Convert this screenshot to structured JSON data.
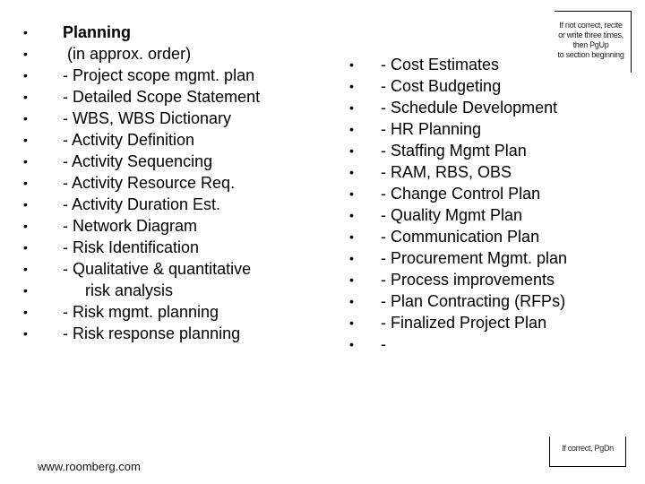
{
  "left_list": [
    {
      "text": "Planning",
      "style": "title"
    },
    {
      "text": " (in approx. order)",
      "style": "normal"
    },
    {
      "text": "- Project scope mgmt. plan",
      "style": "normal"
    },
    {
      "text": "- Detailed Scope Statement",
      "style": "normal"
    },
    {
      "text": "- WBS, WBS Dictionary",
      "style": "normal"
    },
    {
      "text": "- Activity Definition",
      "style": "normal"
    },
    {
      "text": "- Activity Sequencing",
      "style": "normal"
    },
    {
      "text": "- Activity Resource Req.",
      "style": "normal"
    },
    {
      "text": "- Activity Duration Est.",
      "style": "normal"
    },
    {
      "text": "- Network Diagram",
      "style": "normal"
    },
    {
      "text": "- Risk Identification",
      "style": "normal"
    },
    {
      "text": "- Qualitative & quantitative",
      "style": "normal"
    },
    {
      "text": "     risk analysis",
      "style": "normal"
    },
    {
      "text": "- Risk mgmt. planning",
      "style": "normal"
    },
    {
      "text": "- Risk response planning",
      "style": "normal"
    }
  ],
  "right_list": [
    "- Cost Estimates",
    "- Cost Budgeting",
    "- Schedule Development",
    "- HR Planning",
    "- Staffing Mgmt Plan",
    "- RAM, RBS, OBS",
    "- Change Control Plan",
    "- Quality Mgmt Plan",
    "- Communication Plan",
    "- Procurement Mgmt. plan",
    "- Process improvements",
    "- Plan Contracting (RFPs)",
    "- Finalized Project Plan",
    "-"
  ],
  "bullet_glyph": "•",
  "note_top": [
    "If not correct, recite",
    "or write three times,",
    "then PgUp",
    "to section beginning"
  ],
  "note_bottom": "If correct, PgDn",
  "footer": "www.roomberg.com"
}
